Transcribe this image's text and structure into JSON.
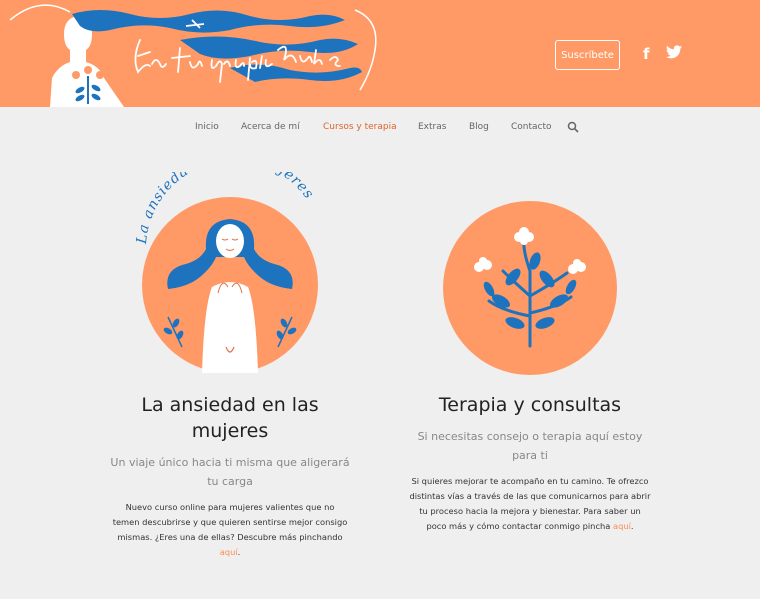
{
  "header": {
    "logo_text": "En tu propia nube",
    "subscribe_label": "Suscríbete",
    "social": [
      {
        "icon": "facebook-icon",
        "glyph": "f"
      },
      {
        "icon": "twitter-icon",
        "glyph": "🐦"
      }
    ]
  },
  "nav": {
    "items": [
      {
        "label": "Inicio",
        "active": false
      },
      {
        "label": "Acerca de mí",
        "active": false
      },
      {
        "label": "Cursos y terapia",
        "active": true
      },
      {
        "label": "Extras",
        "active": false
      },
      {
        "label": "Blog",
        "active": false
      },
      {
        "label": "Contacto",
        "active": false
      }
    ],
    "search_icon": "search-icon"
  },
  "cards": [
    {
      "image_text": "La ansiedad en las mujeres",
      "title": "La ansiedad en las mujeres",
      "subtitle": "Un viaje único hacia ti misma que aligerará tu carga",
      "body": "Nuevo curso online para mujeres valientes que no temen descubrirse y que quieren sentirse mejor consigo mismas. ¿Eres una de ellas? Descubre más pinchando ",
      "link": "aquí",
      "after_link": "."
    },
    {
      "title": "Terapia y consultas",
      "subtitle": "Si necesitas consejo o terapia aquí estoy para ti",
      "body": "Si quieres mejorar te acompaño en tu camino. Te ofrezco distintas vías a través de las que comunicarnos para abrir tu proceso hacia la mejora y bienestar. Para saber un poco más y cómo contactar conmigo pincha ",
      "link": "aquí",
      "after_link": "."
    }
  ],
  "colors": {
    "brand_orange": "#ff9a66",
    "accent_blue": "#1e73be",
    "active_nav": "#e0632d",
    "link": "#ff8a52"
  }
}
